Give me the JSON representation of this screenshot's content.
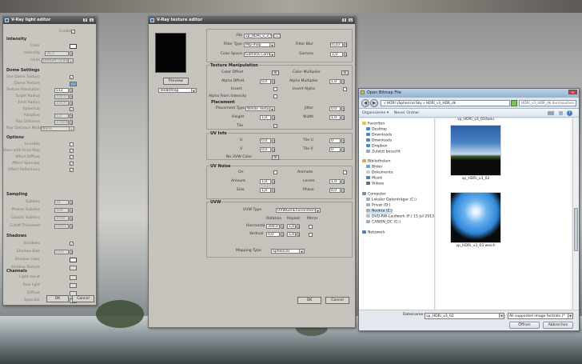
{
  "light_editor": {
    "title": "V-Ray light editor",
    "enabled_label": "Enabled",
    "groups": {
      "intensity": "Intensity",
      "dome": "Dome Settings",
      "options": "Options",
      "sampling": "Sampling",
      "shadows": "Shadows",
      "channels": "Channels"
    },
    "intensity": {
      "color_label": "Color",
      "intensity_label": "Intensity",
      "intensity_value": "30,0",
      "units_label": "Units",
      "units_value": "Default (scalar)"
    },
    "dome": {
      "use_texture": "Use Dome Texture",
      "texture": "Dome Texture",
      "tex_resolution": "Texture Resolution",
      "tex_resolution_value": "512",
      "target_radius": "Target Radius",
      "target_radius_value": "100,0",
      "emit_radius": "Emit Radius",
      "emit_radius_value": "150,0",
      "spherical": "Spherical",
      "adaptive": "Adaptive",
      "adaptive_value": "1,0",
      "ray_distance": "Ray Distance",
      "ray_distance_value": "100000",
      "ray_distance_mode": "Ray Distance Mode",
      "ray_distance_mode_value": "None"
    },
    "options": {
      "invisible": "Invisible",
      "store_irrad": "Store with Irrad Map",
      "affect_diffuse": "Affect Diffuse",
      "affect_specular": "Affect Specular",
      "affect_reflections": "Affect Reflections"
    },
    "sampling": {
      "subdivs": "Subdivs",
      "subdivs_value": "16",
      "photon_subdivs": "Photon Subdivs",
      "photon_subdivs_value": "500",
      "caustic_subdivs": "Caustic Subdivs",
      "caustic_subdivs_value": "1000",
      "cutoff": "Cutoff Threshold",
      "cutoff_value": "0,001"
    },
    "shadows": {
      "shadows": "Shadows",
      "shadow_bias": "Shadow Bias",
      "shadow_bias_value": "0,01",
      "shadow_color": "Shadow Color",
      "shadow_texture": "Shadow Texture"
    },
    "channels": {
      "light_result": "Light result",
      "raw_light": "Raw light",
      "diffuse": "Diffuse",
      "specular": "Specular"
    },
    "ok_label": "OK",
    "cancel_label": "Cancel"
  },
  "texture_editor": {
    "title": "V-Ray texture editor",
    "preview_label": "Preview",
    "type_value": "TexBitmap",
    "file_label": "File",
    "file_value": "vp_HDRi_v_3_047.jpg",
    "browse_label": "...",
    "filter_type_label": "Filter Type",
    "filter_type_value": "Mip-map",
    "filter_blur_label": "Filter Blur",
    "filter_blur_value": "0,10",
    "color_space_label": "Color Space",
    "color_space_value": "Gamma Correcti",
    "gamma_label": "Gamma",
    "gamma_value": "1,0",
    "texture_manipulation": "Texture Manipulation",
    "color_offset": "Color Offset",
    "color_multiplier": "Color Multiplier",
    "alpha_offset": "Alpha Offset",
    "alpha_offset_value": "0,0",
    "alpha_multiplier": "Alpha Multiplier",
    "alpha_multiplier_value": "1,0",
    "invert": "Invert",
    "invert_alpha": "Invert Alpha",
    "alpha_from_intensity": "Alpha From Intensity",
    "m_label": "m",
    "placement": "Placement",
    "placement_type_label": "Placement Type",
    "placement_type_value": "Whole Texture",
    "jitter_label": "Jitter",
    "jitter_value": "0,0",
    "height_label": "Height",
    "height_value": "1,0",
    "width_label": "Width",
    "width_value": "1,0",
    "tile_label": "Tile",
    "uv_info": "UV Info",
    "u_label": "U",
    "u_value": "0,0",
    "tile_u_label": "Tile U",
    "tile_u_value": "0",
    "v_label": "V",
    "v_value": "0,0",
    "tile_v_label": "Tile V",
    "tile_v_value": "0",
    "no_uvw_color": "No UVW Color",
    "uv_noise": "UV Noise",
    "on_label": "On",
    "animate_label": "Animate",
    "amount_label": "Amount",
    "amount_value": "1,0",
    "levels_label": "Levels",
    "levels_value": "1,0",
    "size_label": "Size",
    "size_value": "1,0",
    "phase_label": "Phase",
    "phase_value": "0,0",
    "uvw": "UVW",
    "uvw_type_label": "UVW Type",
    "uvw_type_value": "UVWGenEnvironment",
    "rotation_label": "Rotation",
    "repeat_label": "Repeat",
    "mirror_label": "Mirror",
    "horizontal_label": "Horizontal",
    "horizontal_rotation": "300,0",
    "horizontal_repeat": "1,0",
    "vertical_label": "Vertical",
    "vertical_rotation": "0,0",
    "vertical_repeat": "1,0",
    "mapping_type_label": "Mapping Type",
    "mapping_type_value": "Spherical",
    "ok_label": "OK",
    "cancel_label": "Cancel"
  },
  "file_dialog": {
    "title": "Open Bitmap File",
    "address": "« HDRI vSpherical Sky » HDRI_v3_HDR_dk",
    "search_placeholder": "HDRI_v3_HDR_dk durchsuchen",
    "organize": "Organisieren ▾",
    "new_folder": "Neuer Ordner",
    "nav": {
      "favorites": "Favoriten",
      "desktop": "Desktop",
      "downloads1": "Downloads",
      "downloads2": "Downloads",
      "dropbox": "Dropbox",
      "recent": "Zuletzt besucht",
      "libraries": "Bibliotheken",
      "pictures": "Bilder",
      "documents": "Dokumente",
      "music": "Musik",
      "videos": "Videos",
      "computer": "Computer",
      "local_disk": "Lokaler Datenträger (C:)",
      "private": "Privat (D:)",
      "nookta": "Nookta (E:)",
      "dvd": "DVD-RW-Laufwerk (F:) 15 Jul 2013",
      "canon": "CANON_DC (G:)",
      "network": "Netzwerk"
    },
    "files": [
      {
        "name": "vp_HDRi_v3_02"
      },
      {
        "name": "vp_HDRi_v3_03 weich"
      }
    ],
    "top_partial_caption": "vp_HDRi_v3_01dueu",
    "filename_label": "Dateiname:",
    "filename_value": "vp_HDRi_v3_02",
    "filetype_value": "All supported image formats (*",
    "open_label": "Öffnen",
    "cancel_label": "Abbrechen"
  },
  "colors": {
    "panel": "#c5c3bc",
    "dialog": "#e9ecef",
    "titlebar_max": "#3f3f3f",
    "titlebar_win7": "#93b2d0"
  }
}
